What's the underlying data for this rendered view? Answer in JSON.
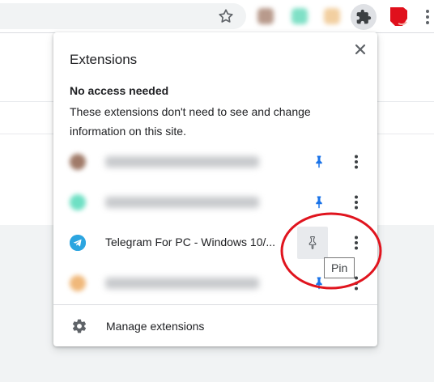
{
  "popup": {
    "title": "Extensions",
    "section_heading": "No access needed",
    "section_description": "These extensions don't need to see and change information on this site.",
    "extensions": [
      {
        "name": "",
        "blurred": true,
        "pinned": true,
        "icon_color": "#a07a68"
      },
      {
        "name": "",
        "blurred": true,
        "pinned": true,
        "icon_color": "#6ee0c4"
      },
      {
        "name": "Telegram For PC - Windows 10/...",
        "blurred": false,
        "pinned": false,
        "icon_color": "#2ca5e0"
      },
      {
        "name": "",
        "blurred": true,
        "pinned": true,
        "icon_color": "#f0b87a"
      }
    ],
    "manage_label": "Manage extensions"
  },
  "tooltip": {
    "text": "Pin"
  },
  "colors": {
    "pin_active": "#1a73e8",
    "pin_inactive": "#5f6368",
    "annotation_circle": "#e0141e"
  }
}
